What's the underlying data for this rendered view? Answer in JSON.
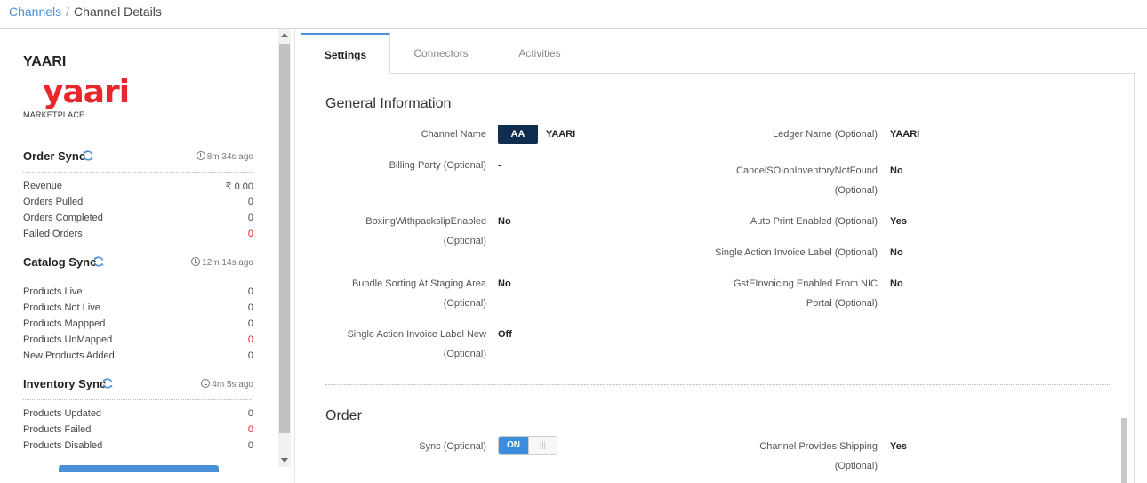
{
  "breadcrumb": {
    "parent": "Channels",
    "separator": "/",
    "current": "Channel Details"
  },
  "channel": {
    "name": "YAARI",
    "logo_text": "yaari",
    "type": "MARKETPLACE"
  },
  "order_sync": {
    "title": "Order Sync",
    "time": "8m 34s ago",
    "rows": [
      {
        "label": "Revenue",
        "value": "₹ 0.00"
      },
      {
        "label": "Orders Pulled",
        "value": "0"
      },
      {
        "label": "Orders Completed",
        "value": "0"
      },
      {
        "label": "Failed Orders",
        "value": "0"
      }
    ]
  },
  "catalog_sync": {
    "title": "Catalog Sync",
    "time": "12m 14s ago",
    "rows": [
      {
        "label": "Products Live",
        "value": "0"
      },
      {
        "label": "Products Not Live",
        "value": "0"
      },
      {
        "label": "Products Mappped",
        "value": "0"
      },
      {
        "label": "Products UnMapped",
        "value": "0"
      },
      {
        "label": "New Products Added",
        "value": "0"
      }
    ]
  },
  "inventory_sync": {
    "title": "Inventory Sync",
    "time": "4m 5s ago",
    "rows": [
      {
        "label": "Products Updated",
        "value": "0"
      },
      {
        "label": "Products Failed",
        "value": "0"
      },
      {
        "label": "Products Disabled",
        "value": "0"
      }
    ]
  },
  "tabs": [
    "Settings",
    "Connectors",
    "Activities"
  ],
  "general": {
    "title": "General Information",
    "channel_name_label": "Channel Name",
    "channel_code": "AA",
    "channel_name_value": "YAARI",
    "ledger_label": "Ledger Name (Optional)",
    "ledger_value": "YAARI",
    "billing_label": "Billing Party (Optional)",
    "billing_value": "-",
    "cancel_label_1": "CancelSOIonInventoryNotFound",
    "cancel_label_2": "(Optional)",
    "cancel_value": "No",
    "boxing_label_1": "BoxingWithpackslipEnabled",
    "boxing_label_2": "(Optional)",
    "boxing_value": "No",
    "autoprint_label": "Auto Print Enabled (Optional)",
    "autoprint_value": "Yes",
    "single_action_label": "Single Action Invoice Label (Optional)",
    "single_action_value": "No",
    "bundle_label_1": "Bundle Sorting At Staging Area",
    "bundle_label_2": "(Optional)",
    "bundle_value": "No",
    "gst_label_1": "GstEInvoicing Enabled From NIC",
    "gst_label_2": "Portal (Optional)",
    "gst_value": "No",
    "single_new_label_1": "Single Action Invoice Label New",
    "single_new_label_2": "(Optional)",
    "single_new_value": "Off"
  },
  "order": {
    "title": "Order",
    "sync_label": "Sync (Optional)",
    "sync_toggle": "ON",
    "shipping_label_1": "Channel Provides Shipping",
    "shipping_label_2": "(Optional)",
    "shipping_value": "Yes"
  }
}
